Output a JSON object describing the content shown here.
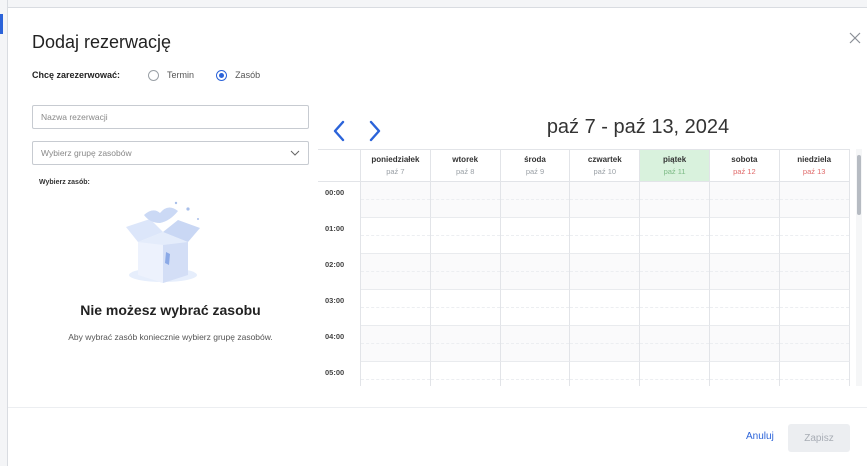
{
  "dialog": {
    "title": "Dodaj rezerwację"
  },
  "reserve_type": {
    "label": "Chcę zarezerwować:",
    "options": [
      {
        "label": "Termin",
        "checked": false
      },
      {
        "label": "Zasób",
        "checked": true
      }
    ]
  },
  "form": {
    "name_placeholder": "Nazwa rezerwacji",
    "group_placeholder": "Wybierz grupę zasobów",
    "resource_label": "Wybierz zasób:"
  },
  "empty_state": {
    "title": "Nie możesz wybrać zasobu",
    "description": "Aby wybrać zasób koniecznie wybierz grupę zasobów."
  },
  "calendar": {
    "range_title": "paź 7 - paź 13, 2024",
    "days": [
      {
        "name": "poniedziałek",
        "date": "paź 7",
        "weekend": false,
        "today": false
      },
      {
        "name": "wtorek",
        "date": "paź 8",
        "weekend": false,
        "today": false
      },
      {
        "name": "środa",
        "date": "paź 9",
        "weekend": false,
        "today": false
      },
      {
        "name": "czwartek",
        "date": "paź 10",
        "weekend": false,
        "today": false
      },
      {
        "name": "piątek",
        "date": "paź 11",
        "weekend": false,
        "today": true
      },
      {
        "name": "sobota",
        "date": "paź 12",
        "weekend": true,
        "today": false
      },
      {
        "name": "niedziela",
        "date": "paź 13",
        "weekend": true,
        "today": false
      }
    ],
    "times": [
      "00:00",
      "01:00",
      "02:00",
      "03:00",
      "04:00",
      "05:00"
    ]
  },
  "footer": {
    "cancel_label": "Anuluj",
    "save_label": "Zapisz"
  },
  "colors": {
    "accent": "#2b63d9",
    "today_bg": "#d9f2dd",
    "weekend_date": "#e06a6a"
  },
  "icons": {
    "close": "close-icon",
    "prev": "chevron-left-icon",
    "next": "chevron-right-icon",
    "dropdown": "chevron-down-icon",
    "illustration": "empty-box-illustration"
  }
}
